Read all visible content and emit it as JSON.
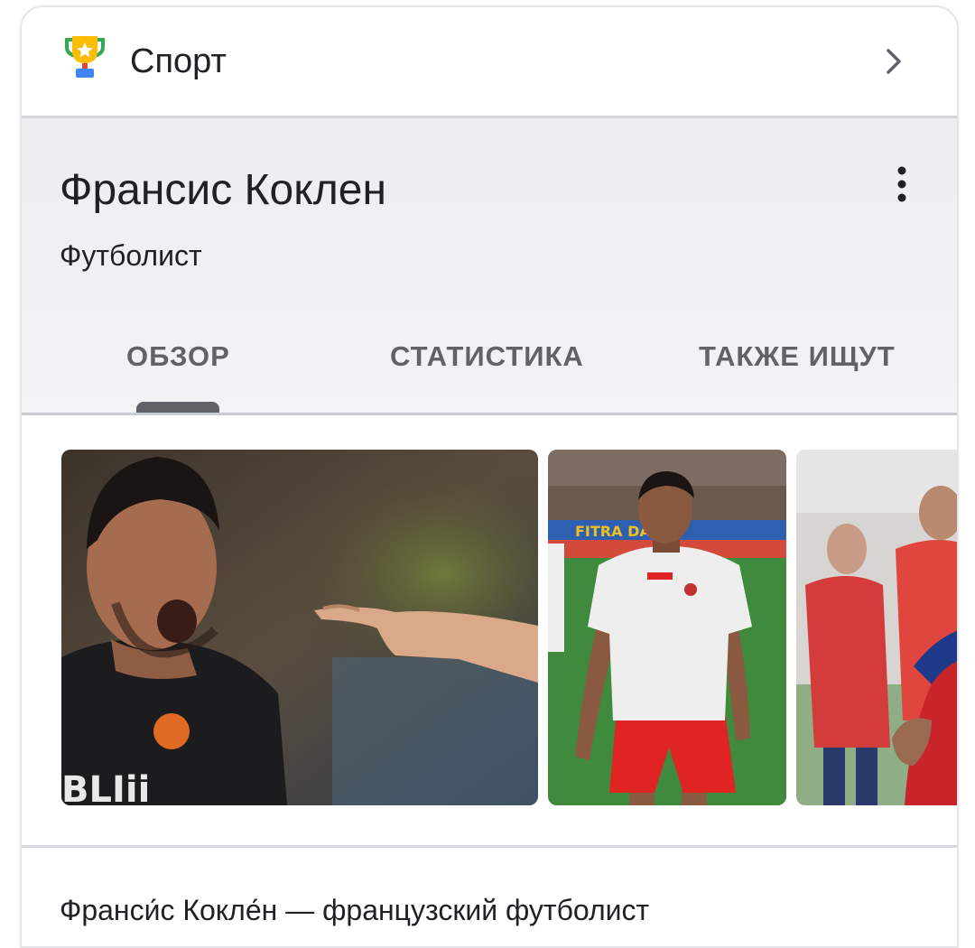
{
  "header": {
    "icon": "trophy-icon",
    "title": "Спорт",
    "chevron_icon": "chevron-right-icon"
  },
  "entity": {
    "name": "Франсис Коклен",
    "subtitle": "Футболист",
    "menu_icon": "more-vertical-icon"
  },
  "tabs": [
    {
      "label": "ОБЗОР",
      "selected": true
    },
    {
      "label": "СТАТИСТИКА",
      "selected": false
    },
    {
      "label": "ТАКЖЕ ИЩУТ",
      "selected": false
    }
  ],
  "images": [
    {
      "name": "player-photo-1"
    },
    {
      "name": "player-photo-2"
    },
    {
      "name": "player-photo-3"
    }
  ],
  "description": {
    "text": "Франси́с Кокле́н — французский футболист"
  },
  "colors": {
    "text_primary": "#202124",
    "text_secondary": "#5f6368",
    "panel_bg": "#eceef0",
    "divider": "#d6d8db"
  }
}
